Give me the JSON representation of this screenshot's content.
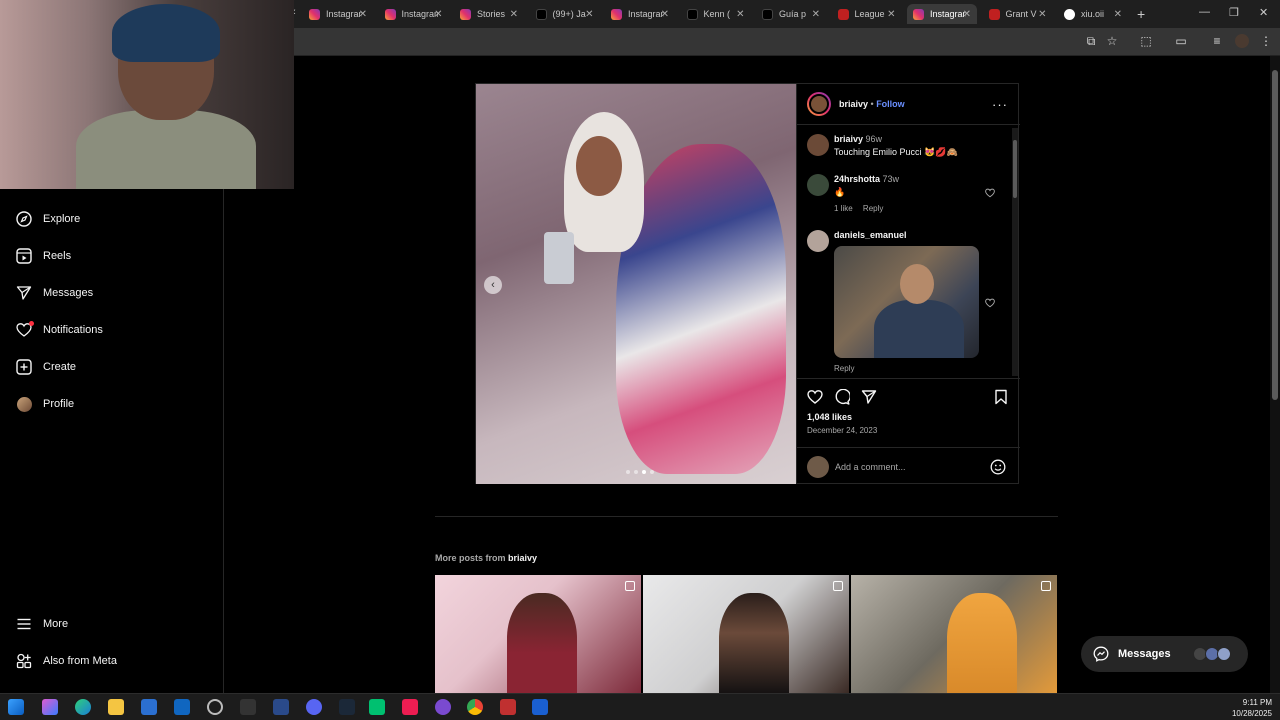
{
  "browser": {
    "tabs": [
      {
        "title": "Instagram",
        "icon": "instagram-icon",
        "kind": "ig"
      },
      {
        "title": "Instagram",
        "icon": "instagram-icon",
        "kind": "ig"
      },
      {
        "title": "Stories",
        "icon": "instagram-icon",
        "kind": "ig"
      },
      {
        "title": "(99+) Ja",
        "icon": "tiktok-icon",
        "kind": "tt"
      },
      {
        "title": "Instagram",
        "icon": "instagram-icon",
        "kind": "ig"
      },
      {
        "title": "Kenn (",
        "icon": "tiktok-icon",
        "kind": "tt"
      },
      {
        "title": "Guía p",
        "icon": "tiktok-icon",
        "kind": "tt"
      },
      {
        "title": "League",
        "icon": "league-icon",
        "kind": "lol"
      },
      {
        "title": "Instagram",
        "icon": "instagram-icon",
        "kind": "ig",
        "active": true
      },
      {
        "title": "Grant V",
        "icon": "league-icon",
        "kind": "lol"
      },
      {
        "title": "xiu.oii",
        "icon": "google-icon",
        "kind": "g"
      }
    ]
  },
  "nav": {
    "explore": "Explore",
    "reels": "Reels",
    "messages": "Messages",
    "notifications": "Notifications",
    "create": "Create",
    "profile": "Profile",
    "more": "More",
    "also_from_meta": "Also from Meta"
  },
  "post": {
    "author": "briaivy",
    "separator": " • ",
    "follow_label": "Follow",
    "caption": {
      "user": "briaivy",
      "time": "96w",
      "text": "Touching Emilio Pucci 😻💋🙈"
    },
    "comments": [
      {
        "user": "24hrshotta",
        "time": "73w",
        "text": "🔥",
        "likes": "1 like",
        "reply": "Reply"
      },
      {
        "user": "daniels_emanuel",
        "time": "",
        "text": "",
        "reply": "Reply"
      }
    ],
    "likes": "1,048 likes",
    "date": "December 24, 2023",
    "comment_placeholder": "Add a comment..."
  },
  "more_posts": {
    "prefix": "More posts from ",
    "user": "briaivy"
  },
  "messages_pill": {
    "label": "Messages"
  },
  "system": {
    "time": "9:11 PM",
    "date": "10/28/2025"
  },
  "colors": {
    "accent_link": "#6a8fff",
    "background": "#000000",
    "border": "#262626"
  }
}
